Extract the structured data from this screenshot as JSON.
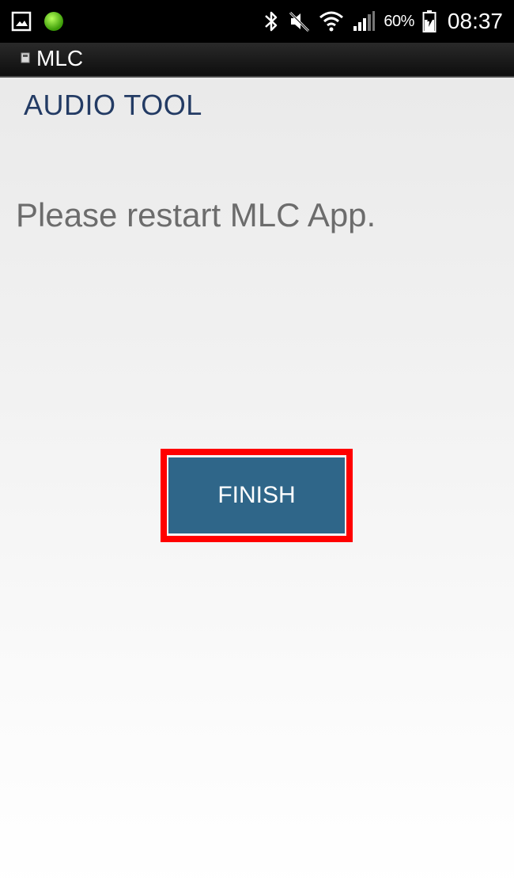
{
  "status_bar": {
    "icons_left": [
      "image-notification-icon",
      "green-dot-icon"
    ],
    "icons_right": [
      "bluetooth-icon",
      "mute-icon",
      "wifi-icon",
      "signal-icon",
      "battery-icon"
    ],
    "battery_percent": "60%",
    "time": "08:37"
  },
  "action_bar": {
    "app_title": "MLC"
  },
  "main": {
    "heading": "AUDIO TOOL",
    "message": "Please restart MLC App.",
    "finish_label": "FINISH"
  },
  "colors": {
    "heading": "#233b64",
    "button_bg": "#2f6689",
    "highlight": "#ff0000",
    "message_text": "#6c6c6c"
  }
}
